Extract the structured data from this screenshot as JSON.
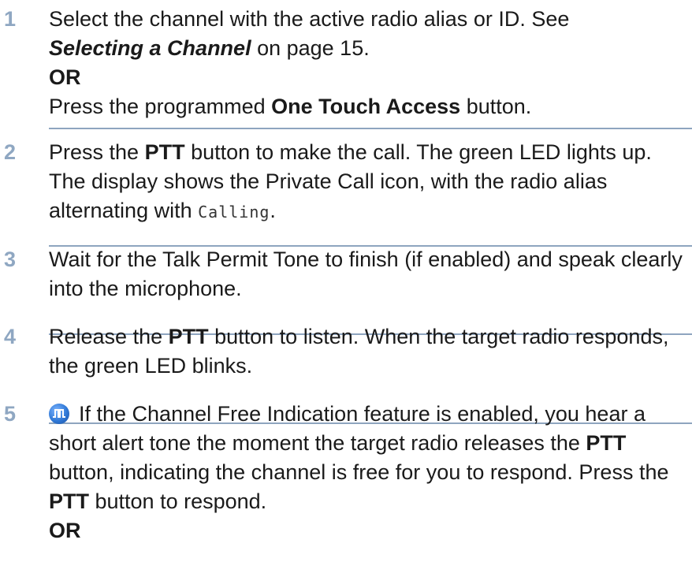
{
  "colors": {
    "step_number": "#8fa7c2",
    "rule": "#8ea5bf",
    "text": "#1a1a1a",
    "icon": "#2f78d6"
  },
  "steps": [
    {
      "number": "1",
      "line1": "Select the channel with the active radio alias or ID. See",
      "ref_title": "Selecting a Channel",
      "ref_rest": " on page 15.",
      "or": "OR",
      "alt_pre": "Press the programmed ",
      "alt_bold": "One Touch Access",
      "alt_post": " button."
    },
    {
      "number": "2",
      "t1": "Press the ",
      "b1": "PTT",
      "t2": " button to make the call. The green LED lights up. The display shows the Private Call icon, with the radio alias alternating with ",
      "display_text": "Calling",
      "t3": "."
    },
    {
      "number": "3",
      "text": "Wait for the Talk Permit Tone to finish (if enabled) and speak clearly into the microphone."
    },
    {
      "number": "4",
      "t1": "Release the ",
      "b1": "PTT",
      "t2": " button to listen. When the target radio responds, the green LED blinks."
    },
    {
      "number": "5",
      "icon": "channel-free-indication-icon",
      "t1": "If the Channel Free Indication feature is enabled, you hear a short alert tone the moment the target radio releases the ",
      "b1": "PTT",
      "t2": " button, indicating the channel is free for you to respond. Press the ",
      "b2": "PTT",
      "t3": " button to respond.",
      "or": "OR"
    }
  ]
}
